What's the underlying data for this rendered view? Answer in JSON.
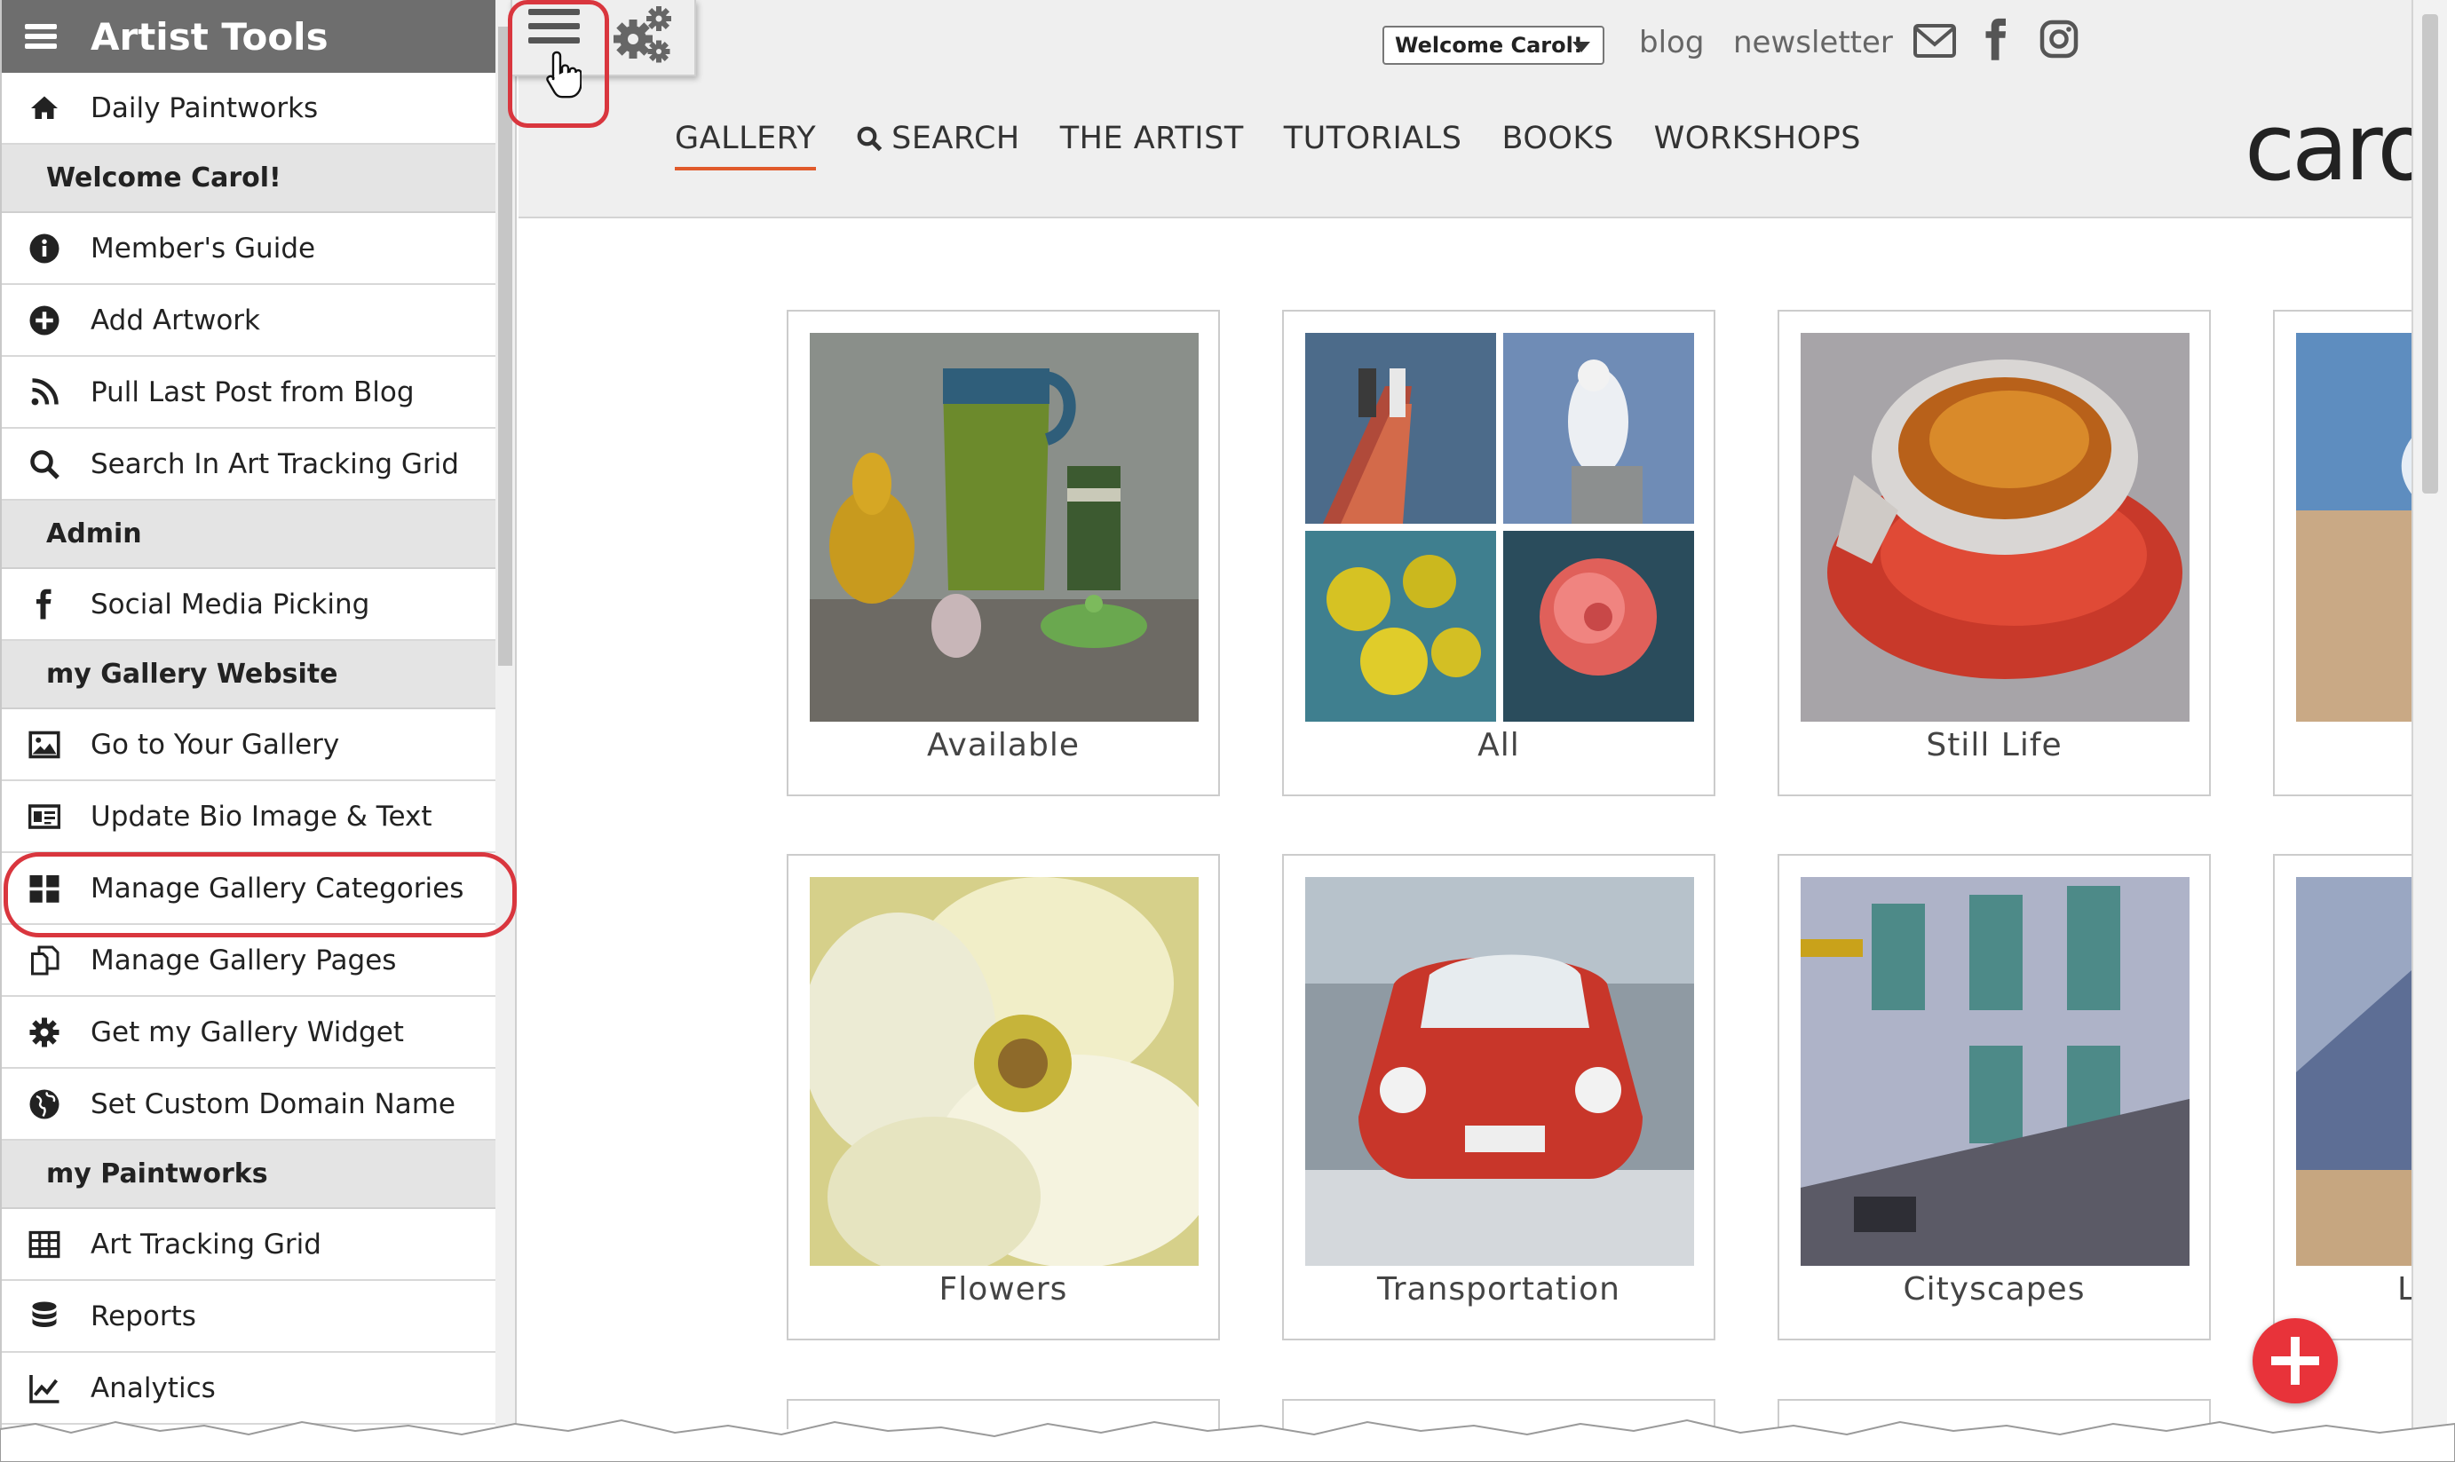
{
  "sidebar": {
    "title": "Artist Tools",
    "daily": "Daily Paintworks",
    "head_welcome": "Welcome Carol!",
    "members_guide": "Member's Guide",
    "add_artwork": "Add Artwork",
    "pull_post": "Pull Last Post from Blog",
    "search_grid": "Search In Art Tracking Grid",
    "head_admin": "Admin",
    "social": "Social Media Picking",
    "head_gallery": "my Gallery Website",
    "go_gallery": "Go to Your Gallery",
    "update_bio": "Update Bio Image & Text",
    "manage_categories": "Manage Gallery Categories",
    "manage_pages": "Manage Gallery Pages",
    "widget": "Get my Gallery Widget",
    "domain": "Set Custom Domain Name",
    "head_paintworks": "my Paintworks",
    "tracking_grid": "Art Tracking Grid",
    "reports": "Reports",
    "analytics": "Analytics"
  },
  "header": {
    "welcome_select": "Welcome Carol!",
    "blog": "blog",
    "newsletter": "newsletter",
    "nav": [
      "GALLERY",
      "SEARCH",
      "THE ARTIST",
      "TUTORIALS",
      "BOOKS",
      "WORKSHOPS"
    ],
    "logo": "carol"
  },
  "gallery": [
    "Available",
    "All",
    "Still Life",
    "Flowers",
    "Transportation",
    "Cityscapes",
    "L"
  ],
  "colors": {
    "accent": "#e05a2b",
    "highlight": "#d9363e",
    "fab": "#e8333a",
    "sidebar_title": "#6e6e6e"
  }
}
